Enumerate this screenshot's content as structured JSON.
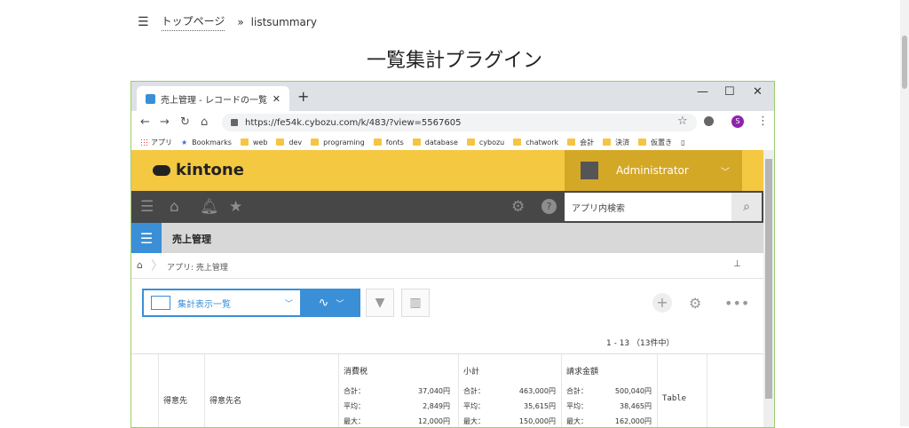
{
  "nav": {
    "home": "トップページ",
    "sep": "»",
    "current": "listsummary"
  },
  "page_title": "一覧集計プラグイン",
  "browser": {
    "tab_title": "売上管理 - レコードの一覧",
    "url": "https://fe54k.cybozu.com/k/483/?view=5567605",
    "profile": "S",
    "bookmarks": [
      {
        "label": "アプリ",
        "icon": "apps-icon"
      },
      {
        "label": "Bookmarks",
        "icon": "star-icon"
      },
      {
        "label": "web",
        "icon": "folder-icon"
      },
      {
        "label": "dev",
        "icon": "folder-icon"
      },
      {
        "label": "programing",
        "icon": "folder-icon"
      },
      {
        "label": "fonts",
        "icon": "folder-icon"
      },
      {
        "label": "database",
        "icon": "folder-icon"
      },
      {
        "label": "cybozu",
        "icon": "folder-icon"
      },
      {
        "label": "chatwork",
        "icon": "folder-icon"
      },
      {
        "label": "会計",
        "icon": "folder-icon"
      },
      {
        "label": "決済",
        "icon": "folder-icon"
      },
      {
        "label": "仮置き",
        "icon": "folder-icon"
      }
    ]
  },
  "kintone": {
    "logo": "kintone",
    "user": "Administrator",
    "search_placeholder": "アプリ内検索",
    "app_name": "売上管理",
    "breadcrumb": "アプリ: 売上管理",
    "view_name": "集計表示一覧",
    "count": "1 - 13 （13件中）"
  },
  "table": {
    "col1": "得意先",
    "col2": "得意先名",
    "col6": "Table",
    "agg_cols": [
      {
        "header": "消費税",
        "rows": [
          {
            "k": "合計：",
            "v": "37,040円"
          },
          {
            "k": "平均：",
            "v": "2,849円"
          },
          {
            "k": "最大：",
            "v": "12,000円"
          }
        ]
      },
      {
        "header": "小計",
        "rows": [
          {
            "k": "合計：",
            "v": "463,000円"
          },
          {
            "k": "平均：",
            "v": "35,615円"
          },
          {
            "k": "最大：",
            "v": "150,000円"
          }
        ]
      },
      {
        "header": "請求金額",
        "rows": [
          {
            "k": "合計：",
            "v": "500,040円"
          },
          {
            "k": "平均：",
            "v": "38,465円"
          },
          {
            "k": "最大：",
            "v": "162,000円"
          }
        ]
      }
    ]
  },
  "colors": {
    "kintone_yellow": "#f5c842",
    "user_gold": "#d4a827",
    "toolbar_dark": "#474747",
    "accent_blue": "#3a8fd6"
  }
}
